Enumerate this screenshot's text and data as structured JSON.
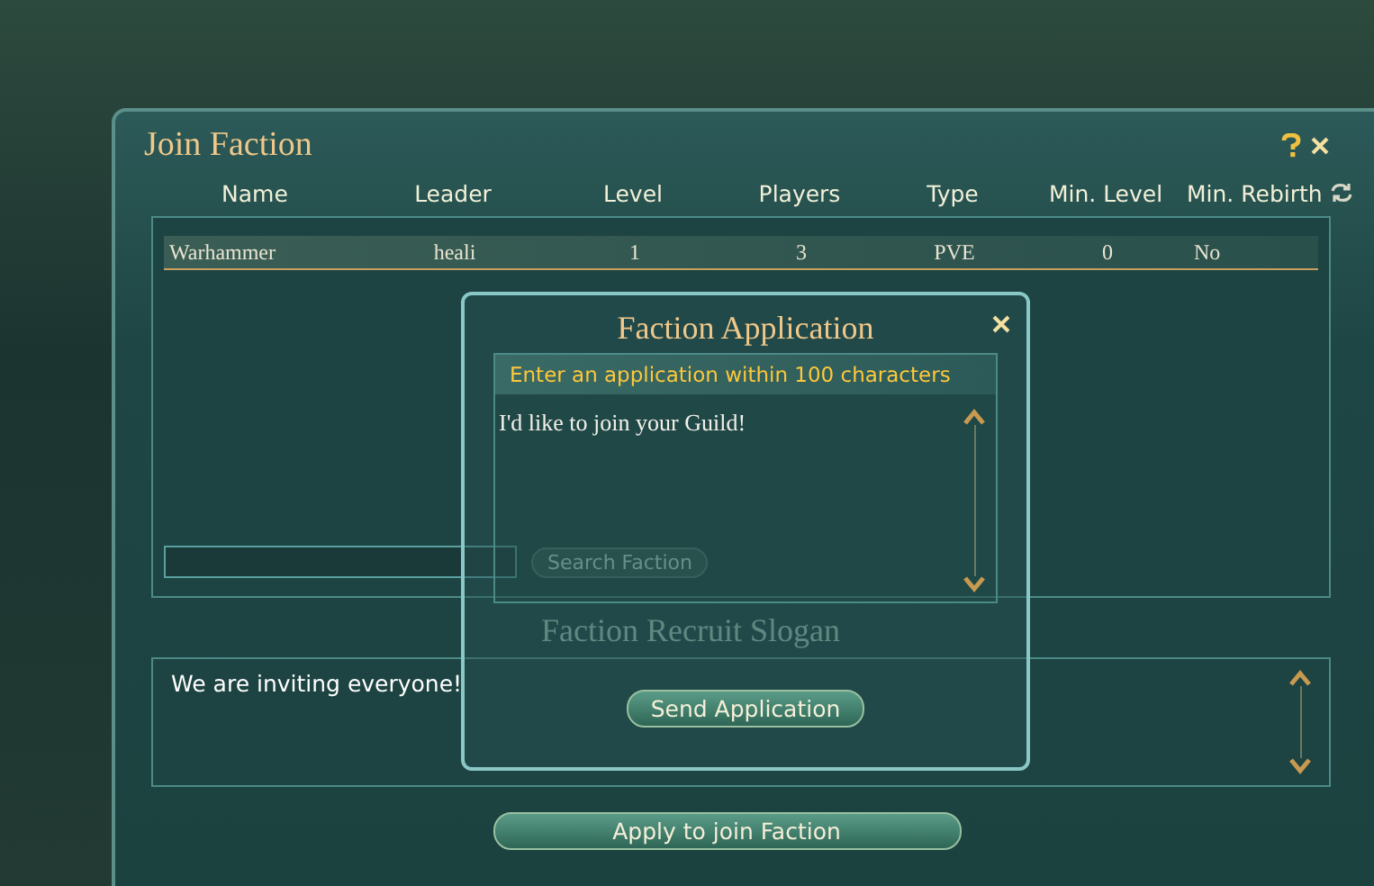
{
  "window": {
    "title": "Join Faction"
  },
  "table": {
    "columns": [
      "Name",
      "Leader",
      "Level",
      "Players",
      "Type",
      "Min. Level",
      "Min. Rebirth"
    ],
    "rows": [
      {
        "cells": [
          "Warhammer",
          "heali",
          "1",
          "3",
          "PVE",
          "0",
          "No"
        ],
        "selected": true
      }
    ]
  },
  "search": {
    "button": "Search Faction"
  },
  "slogan": {
    "title": "Faction Recruit Slogan",
    "text": "We are inviting everyone!"
  },
  "apply_button": "Apply to join Faction",
  "dialog": {
    "title": "Faction Application",
    "hint": "Enter an application within 100 characters",
    "value": "I'd like to join your Guild!",
    "button": "Send Application"
  }
}
